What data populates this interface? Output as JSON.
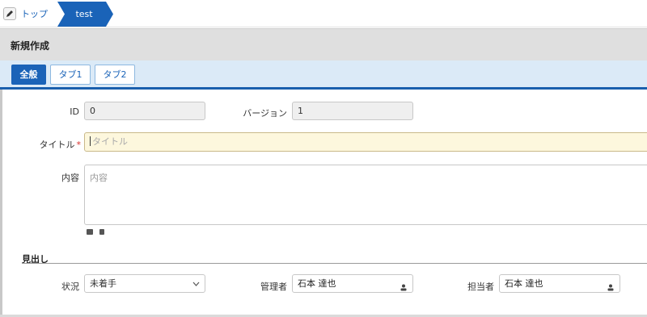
{
  "breadcrumb": {
    "home_label": "トップ",
    "current_label": "test",
    "accent_color": "#1a63b8"
  },
  "page": {
    "title": "新規作成"
  },
  "tabs": [
    {
      "label": "全般",
      "active": true
    },
    {
      "label": "タブ1",
      "active": false
    },
    {
      "label": "タブ2",
      "active": false
    }
  ],
  "form": {
    "id": {
      "label": "ID",
      "value": "0"
    },
    "version": {
      "label": "バージョン",
      "value": "1"
    },
    "title": {
      "label": "タイトル",
      "required_mark": "*",
      "placeholder": "タイトル",
      "value": ""
    },
    "content": {
      "label": "内容",
      "placeholder": "内容"
    },
    "heading": {
      "label": "見出し"
    },
    "status": {
      "label": "状況",
      "value": "未着手"
    },
    "manager": {
      "label": "管理者",
      "value": "石本 達也"
    },
    "owner": {
      "label": "担当者",
      "value": "石本 達也"
    }
  },
  "icons": {
    "home": "pencil-icon",
    "attach_image": "image-icon",
    "attach_file": "file-icon",
    "user": "person-icon",
    "dropdown": "chevron-down-icon"
  }
}
